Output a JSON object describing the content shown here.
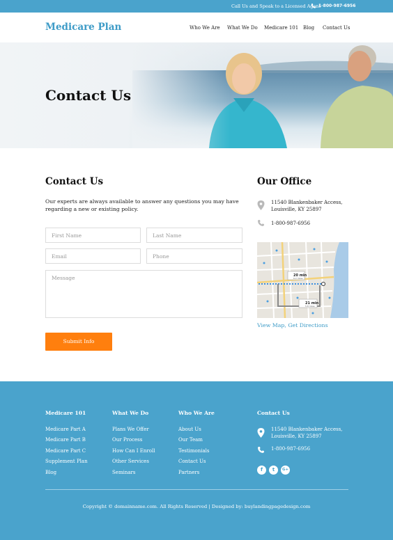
{
  "topbar": {
    "message": "Call Us and Speak to a Licensed Agent",
    "phone": "1-800-987-6956"
  },
  "header": {
    "logo": "Medicare Plan",
    "nav": [
      "Who We Are",
      "What We Do",
      "Medicare 101",
      "Blog",
      "Contact Us"
    ]
  },
  "hero": {
    "title": "Contact Us"
  },
  "contact": {
    "title": "Contact Us",
    "intro": "Our experts are always available to answer any questions you may have regarding a new or existing policy.",
    "placeholders": {
      "first": "First Name",
      "last": "Last Name",
      "email": "Email",
      "phone": "Phone",
      "message": "Message"
    },
    "submit": "Submit Info"
  },
  "office": {
    "title": "Our Office",
    "address_line1": "11540 Blankenbaker Access,",
    "address_line2": "Louisville, KY 25897",
    "phone": "1-800-987-6956",
    "map_link": "View Map, Get Directions",
    "map_labels": {
      "time1": "20 min",
      "dist1": "6.2 miles",
      "time2": "21 min",
      "dist2": "5.8 miles"
    }
  },
  "footer": {
    "col1": {
      "title": "Medicare 101",
      "items": [
        "Medicare Part A",
        "Medicare Part B",
        "Medicare Part C",
        "Supplement Plan",
        "Blog"
      ]
    },
    "col2": {
      "title": "What We Do",
      "items": [
        "Plans We Offer",
        "Our Process",
        "How Can I Enroll",
        "Other Services",
        "Seminars"
      ]
    },
    "col3": {
      "title": "Who We Are",
      "items": [
        "About Us",
        "Our Team",
        "Testimonials",
        "Contact Us",
        "Partners"
      ]
    },
    "col4": {
      "title": "Contact Us",
      "address_line1": "11540 Blankenbaker Access,",
      "address_line2": "Louisville, KY 25897",
      "phone": "1-800-987-6956"
    },
    "social": {
      "facebook": "f",
      "twitter": "t",
      "google": "G+"
    },
    "copyright": "Copyright © domainname.com. All Rights Reserved  |  Designed by: buylandingpagedesign.com"
  },
  "colors": {
    "primary": "#4aa3cc",
    "accent": "#ff7f0e",
    "logo": "#3d9bc7"
  }
}
